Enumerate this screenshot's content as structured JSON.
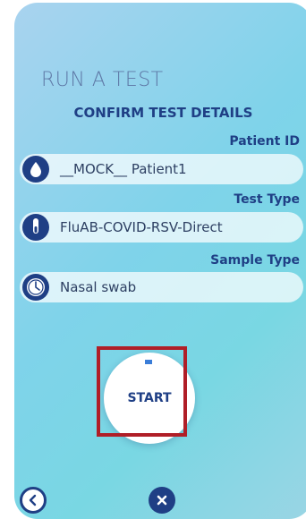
{
  "screen": {
    "title": "RUN A TEST",
    "subtitle": "CONFIRM TEST DETAILS"
  },
  "fields": [
    {
      "label": "Patient ID",
      "value": "__MOCK__ Patient1",
      "icon": "droplet-icon"
    },
    {
      "label": "Test Type",
      "value": "FluAB-COVID-RSV-Direct",
      "icon": "test-tube-icon"
    },
    {
      "label": "Sample Type",
      "value": "Nasal swab",
      "icon": "swab-icon"
    }
  ],
  "actions": {
    "start_label": "START",
    "back_icon": "chevron-left-icon",
    "close_icon": "close-icon"
  },
  "colors": {
    "primary": "#1f3f85",
    "title": "#5e78a6",
    "highlight": "#b01e27",
    "background_start": "#a9d3ef",
    "background_end": "#79d7e3"
  }
}
